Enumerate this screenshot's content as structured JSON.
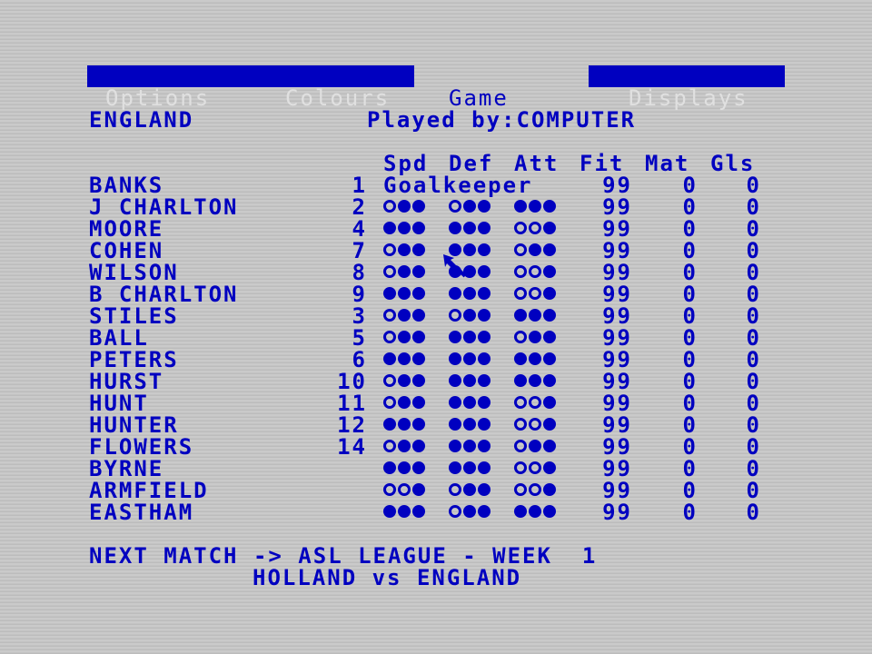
{
  "menu": {
    "options": "Options",
    "colours": "Colours",
    "game": "Game",
    "displays": "Displays"
  },
  "team": {
    "name": "ENGLAND",
    "played_by": "Played by:COMPUTER"
  },
  "columns": {
    "spd": "Spd",
    "def": "Def",
    "att": "Att",
    "fit": "Fit",
    "mat": "Mat",
    "gls": "Gls"
  },
  "players": [
    {
      "name": "BANKS",
      "num": "1",
      "role": "Goalkeeper",
      "fit": "99",
      "mat": "0",
      "gls": "0"
    },
    {
      "name": "J CHARLTON",
      "num": "2",
      "spd": [
        0,
        1,
        1
      ],
      "def": [
        0,
        1,
        1
      ],
      "att": [
        1,
        1,
        1
      ],
      "fit": "99",
      "mat": "0",
      "gls": "0"
    },
    {
      "name": "MOORE",
      "num": "4",
      "spd": [
        1,
        1,
        1
      ],
      "def": [
        1,
        1,
        1
      ],
      "att": [
        0,
        0,
        1
      ],
      "fit": "99",
      "mat": "0",
      "gls": "0"
    },
    {
      "name": "COHEN",
      "num": "7",
      "spd": [
        0,
        1,
        1
      ],
      "def": [
        1,
        1,
        1
      ],
      "att": [
        0,
        1,
        1
      ],
      "fit": "99",
      "mat": "0",
      "gls": "0"
    },
    {
      "name": "WILSON",
      "num": "8",
      "spd": [
        0,
        1,
        1
      ],
      "def": [
        1,
        1,
        1
      ],
      "att": [
        0,
        0,
        1
      ],
      "fit": "99",
      "mat": "0",
      "gls": "0"
    },
    {
      "name": "B CHARLTON",
      "num": "9",
      "spd": [
        1,
        1,
        1
      ],
      "def": [
        1,
        1,
        1
      ],
      "att": [
        0,
        0,
        1
      ],
      "fit": "99",
      "mat": "0",
      "gls": "0"
    },
    {
      "name": "STILES",
      "num": "3",
      "spd": [
        0,
        1,
        1
      ],
      "def": [
        0,
        1,
        1
      ],
      "att": [
        1,
        1,
        1
      ],
      "fit": "99",
      "mat": "0",
      "gls": "0"
    },
    {
      "name": "BALL",
      "num": "5",
      "spd": [
        0,
        1,
        1
      ],
      "def": [
        1,
        1,
        1
      ],
      "att": [
        0,
        1,
        1
      ],
      "fit": "99",
      "mat": "0",
      "gls": "0"
    },
    {
      "name": "PETERS",
      "num": "6",
      "spd": [
        1,
        1,
        1
      ],
      "def": [
        1,
        1,
        1
      ],
      "att": [
        1,
        1,
        1
      ],
      "fit": "99",
      "mat": "0",
      "gls": "0"
    },
    {
      "name": "HURST",
      "num": "10",
      "spd": [
        0,
        1,
        1
      ],
      "def": [
        1,
        1,
        1
      ],
      "att": [
        1,
        1,
        1
      ],
      "fit": "99",
      "mat": "0",
      "gls": "0"
    },
    {
      "name": "HUNT",
      "num": "11",
      "spd": [
        0,
        1,
        1
      ],
      "def": [
        1,
        1,
        1
      ],
      "att": [
        0,
        0,
        1
      ],
      "fit": "99",
      "mat": "0",
      "gls": "0"
    },
    {
      "name": "HUNTER",
      "num": "12",
      "spd": [
        1,
        1,
        1
      ],
      "def": [
        1,
        1,
        1
      ],
      "att": [
        0,
        0,
        1
      ],
      "fit": "99",
      "mat": "0",
      "gls": "0"
    },
    {
      "name": "FLOWERS",
      "num": "14",
      "spd": [
        0,
        1,
        1
      ],
      "def": [
        1,
        1,
        1
      ],
      "att": [
        0,
        1,
        1
      ],
      "fit": "99",
      "mat": "0",
      "gls": "0"
    },
    {
      "name": "BYRNE",
      "num": "",
      "spd": [
        1,
        1,
        1
      ],
      "def": [
        1,
        1,
        1
      ],
      "att": [
        0,
        0,
        1
      ],
      "fit": "99",
      "mat": "0",
      "gls": "0"
    },
    {
      "name": "ARMFIELD",
      "num": "",
      "spd": [
        0,
        0,
        1
      ],
      "def": [
        0,
        1,
        1
      ],
      "att": [
        0,
        0,
        1
      ],
      "fit": "99",
      "mat": "0",
      "gls": "0"
    },
    {
      "name": "EASTHAM",
      "num": "",
      "spd": [
        1,
        1,
        1
      ],
      "def": [
        0,
        1,
        1
      ],
      "att": [
        1,
        1,
        1
      ],
      "fit": "99",
      "mat": "0",
      "gls": "0"
    }
  ],
  "next_match": {
    "line1": "NEXT MATCH -> ASL LEAGUE - WEEK  1",
    "line2": "HOLLAND vs ENGLAND"
  },
  "colors": {
    "background": "#c8c8c8",
    "ink": "#0000c0",
    "menu_text": "#e0e0e0"
  },
  "icons": {
    "cursor": "arrow-pointer-icon"
  }
}
